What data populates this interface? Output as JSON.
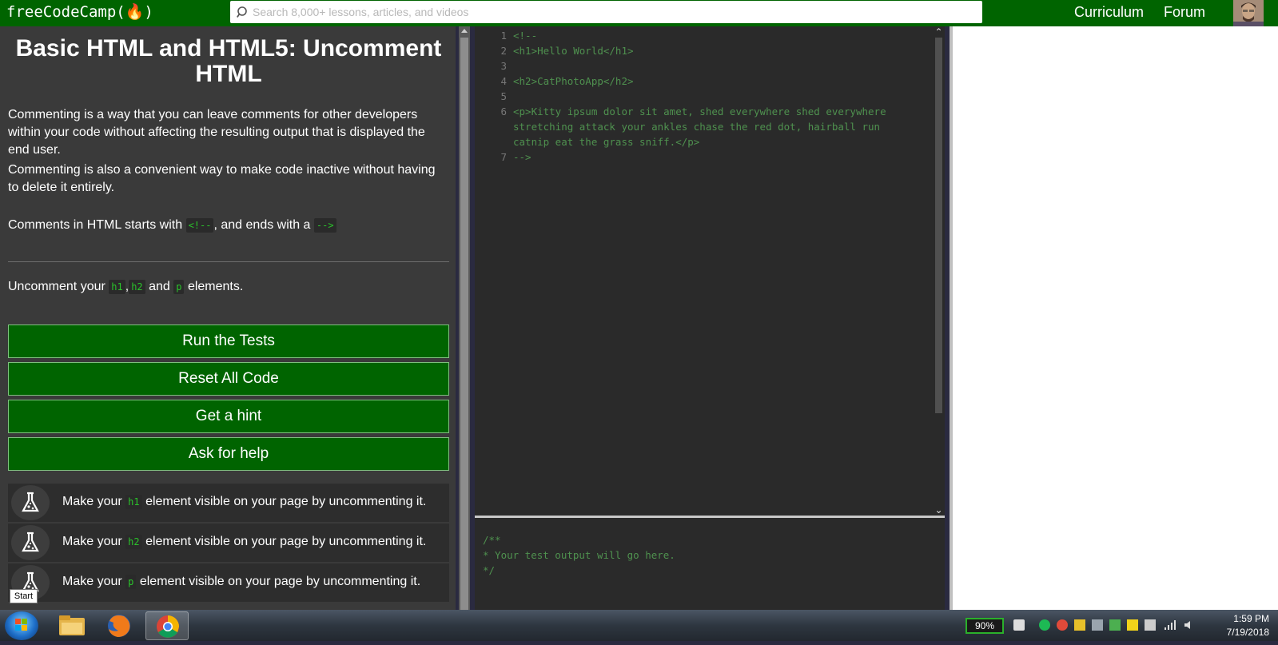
{
  "nav": {
    "logo": "freeCodeCamp(🔥)",
    "search_placeholder": "Search 8,000+ lessons, articles, and videos",
    "links": [
      "Curriculum",
      "Forum"
    ]
  },
  "challenge": {
    "title": "Basic HTML and HTML5: Uncomment HTML",
    "description": [
      "Commenting is a way that you can leave comments for other developers within your code without affecting the resulting output that is displayed the end user.",
      "Commenting is also a convenient way to make code inactive without having to delete it entirely."
    ],
    "comments_note": {
      "prefix": "Comments in HTML starts with",
      "open_tag": "<!--",
      "middle": ", and ends with a",
      "close_tag": "-->"
    },
    "instruction": {
      "prefix": "Uncomment your",
      "code1": "h1",
      "sep1": ",",
      "code2": "h2",
      "sep2": "and",
      "code3": "p",
      "suffix": "elements."
    }
  },
  "buttons": {
    "run": "Run the Tests",
    "reset": "Reset All Code",
    "hint": "Get a hint",
    "help": "Ask for help"
  },
  "tests": [
    {
      "prefix": "Make your",
      "code": "h1",
      "suffix": "element visible on your page by uncommenting it."
    },
    {
      "prefix": "Make your",
      "code": "h2",
      "suffix": "element visible on your page by uncommenting it."
    },
    {
      "prefix": "Make your",
      "code": "p",
      "suffix": "element visible on your page by uncommenting it."
    }
  ],
  "start_tooltip": "Start",
  "editor": {
    "lines": [
      {
        "n": "1",
        "text": "<!--"
      },
      {
        "n": "2",
        "text": "<h1>Hello World</h1>"
      },
      {
        "n": "3",
        "text": ""
      },
      {
        "n": "4",
        "text": "<h2>CatPhotoApp</h2>"
      },
      {
        "n": "5",
        "text": ""
      },
      {
        "n": "6",
        "text": "<p>Kitty ipsum dolor sit amet, shed everywhere shed everywhere"
      },
      {
        "n": "",
        "text": "stretching attack your ankles chase the red dot, hairball run"
      },
      {
        "n": "",
        "text": "catnip eat the grass sniff.</p>"
      },
      {
        "n": "7",
        "text": "-->"
      }
    ]
  },
  "output": {
    "lines": [
      "/**",
      "* Your test output will go here.",
      "*/"
    ]
  },
  "taskbar": {
    "battery": "90%",
    "time": "1:59 PM",
    "date": "7/19/2018"
  }
}
